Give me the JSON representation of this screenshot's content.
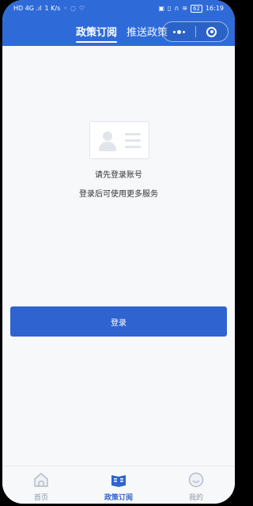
{
  "status_bar": {
    "left_indicators": "HD 4G .ıl",
    "speed": "1 K/s",
    "battery": "62",
    "time": "16:19"
  },
  "header": {
    "tabs": [
      {
        "label": "政策订阅",
        "active": true
      },
      {
        "label": "推送政策",
        "active": false
      }
    ],
    "capsule_more_icon": "more-dots-icon",
    "capsule_close_icon": "target-circle-icon"
  },
  "main": {
    "prompt_title": "请先登录账号",
    "prompt_subtitle": "登录后可使用更多服务",
    "login_button": "登录"
  },
  "tabbar": {
    "items": [
      {
        "label": "首页",
        "icon": "home-icon",
        "active": false
      },
      {
        "label": "政策订阅",
        "icon": "subscription-book-icon",
        "active": true
      },
      {
        "label": "我的",
        "icon": "profile-face-icon",
        "active": false
      }
    ]
  },
  "colors": {
    "brand": "#2f6bd8",
    "button": "#2f63cf",
    "background": "#f7f8fa",
    "tab_inactive": "#8d97a8"
  }
}
